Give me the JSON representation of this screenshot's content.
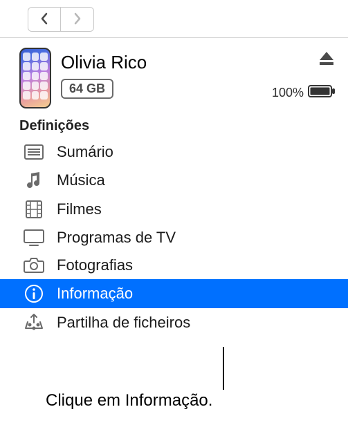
{
  "device": {
    "name": "Olivia Rico",
    "storage": "64 GB",
    "battery": "100%"
  },
  "section": {
    "title": "Definições"
  },
  "sidebar": {
    "items": [
      {
        "label": "Sumário"
      },
      {
        "label": "Música"
      },
      {
        "label": "Filmes"
      },
      {
        "label": "Programas de TV"
      },
      {
        "label": "Fotografias"
      },
      {
        "label": "Informação"
      },
      {
        "label": "Partilha de ficheiros"
      }
    ]
  },
  "callout": {
    "text": "Clique em Informação."
  }
}
